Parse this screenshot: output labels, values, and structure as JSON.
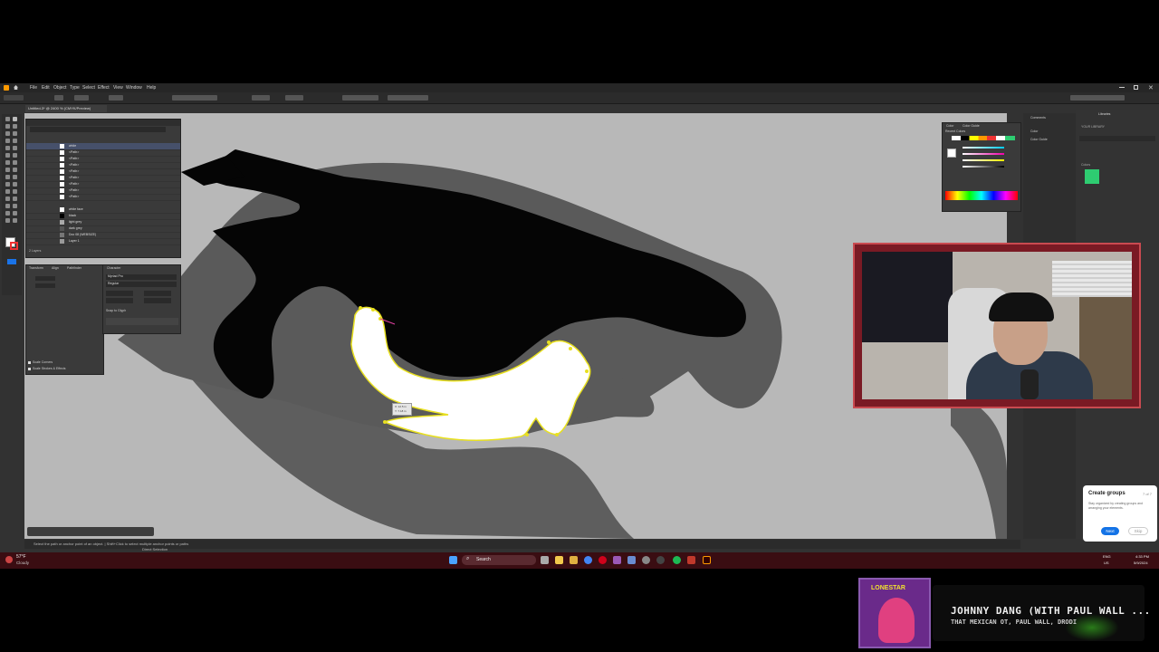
{
  "menu": {
    "items": [
      "File",
      "Edit",
      "Object",
      "Type",
      "Select",
      "Effect",
      "View",
      "Window",
      "Help"
    ]
  },
  "document": {
    "tab_title": "Untitled-3* @ 2400 % (CMYK/Preview)"
  },
  "layers": {
    "rows": [
      "white",
      "<Path>",
      "<Path>",
      "<Path>",
      "<Path>",
      "<Path>",
      "<Path>",
      "<Path>",
      "<Path>",
      "white face",
      "black",
      "light grey",
      "dark grey",
      "Doc 08 (WEBSIZE)",
      "Layer 1"
    ],
    "footer": "2 Layers"
  },
  "panels": {
    "transform_tab": "Transform",
    "align_tab": "Align",
    "pathfinder_tab": "Pathfinder",
    "character_tab": "Character",
    "font_name": "Myriad Pro",
    "font_style": "Regular",
    "scale_corners": "Scale Corners",
    "scale_strokes": "Scale Strokes & Effects",
    "snap_to_glyph": "Snap to Glyph",
    "color_tab": "Color",
    "color_guide_tab": "Color Guide",
    "recent_colors": "Recent Colors",
    "dock_comments": "Comments",
    "dock_color": "Color",
    "dock_color_guide": "Color Guide",
    "libraries_tab": "Libraries",
    "your_library": "YOUR LIBRARY",
    "colors_section": "Colors"
  },
  "statusbar": {
    "hint": "Select the path or anchor point of an object. | Shift+Click to select multiple anchor points or paths",
    "mode": "Direct Selection"
  },
  "tooltip": {
    "line1": "X: 12.5 in",
    "line2": "Y: 7.18 in"
  },
  "popup": {
    "title": "Create groups",
    "step": "7 of 7",
    "body": "Stay organized by creating groups and arranging your elements.",
    "next": "Next",
    "skip": "Skip"
  },
  "taskbar": {
    "weather_temp": "57°F",
    "weather_desc": "Cloudy",
    "search": "Search",
    "lang": "ENG",
    "region": "US",
    "time": "4:33 PM",
    "date": "5/9/2024"
  },
  "music": {
    "title": "JOHNNY DANG (WITH PAUL WALL ...",
    "artist": "THAT MEXICAN OT, PAUL WALL, DRODI",
    "album_text": "LONESTAR"
  },
  "colors": {
    "taskbar": "#3a0d12",
    "webcam_border": "#c94a50",
    "accent_green": "#2ecc71",
    "highlight_yellow": "#e8e020"
  }
}
